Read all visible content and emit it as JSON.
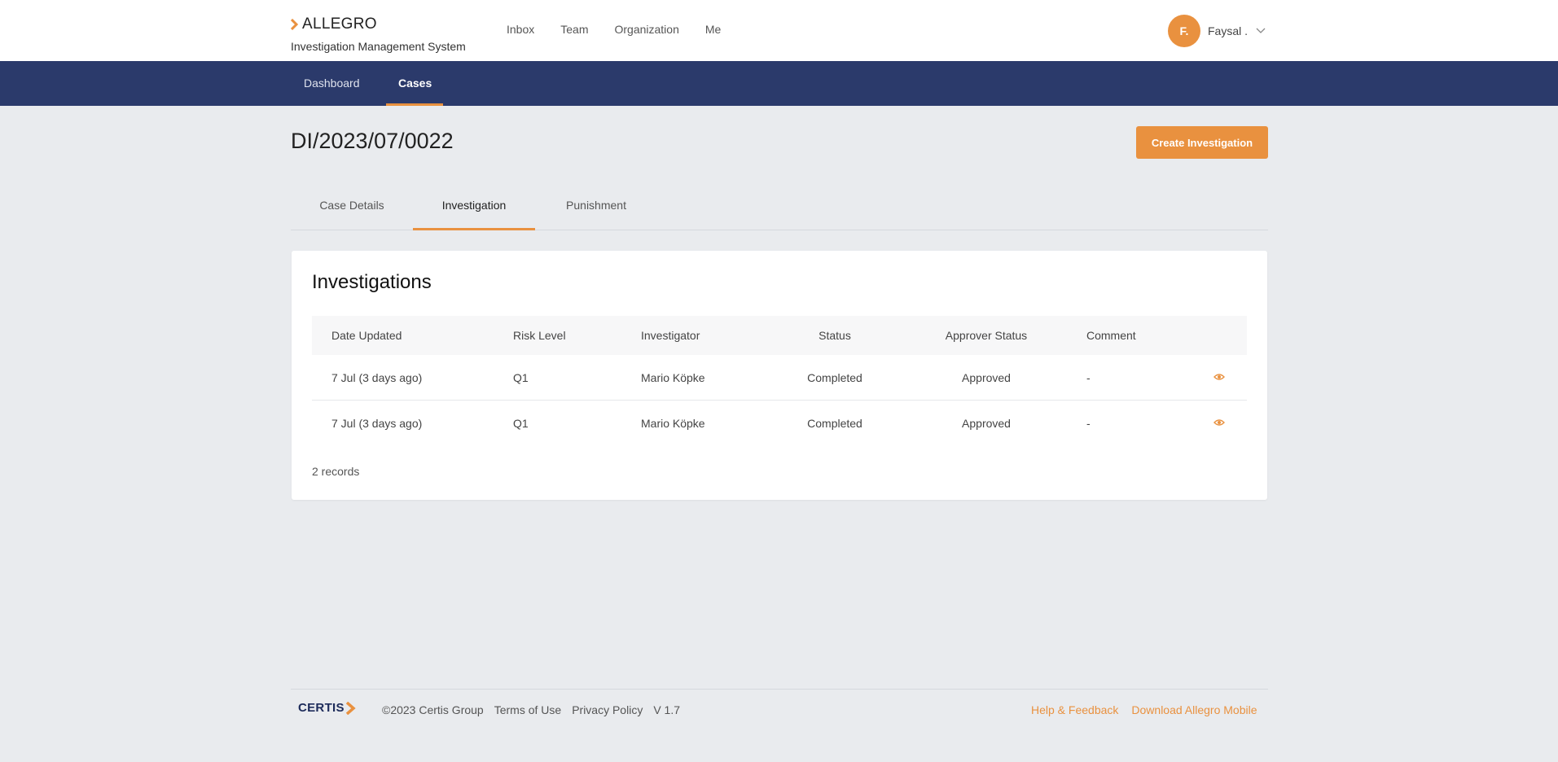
{
  "header": {
    "brand_name": "ALLEGRO",
    "brand_subtitle": "Investigation Management System",
    "nav": [
      "Inbox",
      "Team",
      "Organization",
      "Me"
    ],
    "user_initial": "F.",
    "user_name": "Faysal ."
  },
  "subnav": {
    "items": [
      "Dashboard",
      "Cases"
    ],
    "active": "Cases"
  },
  "case": {
    "title": "DI/2023/07/0022",
    "create_button": "Create Investigation"
  },
  "tabs": {
    "items": [
      "Case Details",
      "Investigation",
      "Punishment"
    ],
    "active": "Investigation"
  },
  "investigations": {
    "title": "Investigations",
    "columns": [
      "Date Updated",
      "Risk Level",
      "Investigator",
      "Status",
      "Approver Status",
      "Comment"
    ],
    "rows": [
      {
        "date": "7 Jul (3 days ago)",
        "risk": "Q1",
        "investigator": "Mario Köpke",
        "status": "Completed",
        "approver_status": "Approved",
        "comment": "-"
      },
      {
        "date": "7 Jul (3 days ago)",
        "risk": "Q1",
        "investigator": "Mario Köpke",
        "status": "Completed",
        "approver_status": "Approved",
        "comment": "-"
      }
    ],
    "records": "2 records"
  },
  "footer": {
    "logo": "CERTIS",
    "links": [
      "©2023 Certis Group",
      "Terms of Use",
      "Privacy Policy",
      "V 1.7"
    ],
    "right_links": [
      "Help & Feedback",
      "Download Allegro Mobile"
    ]
  },
  "colors": {
    "accent": "#e9913f",
    "navy": "#2b3a6b",
    "background": "#e9ebee"
  }
}
